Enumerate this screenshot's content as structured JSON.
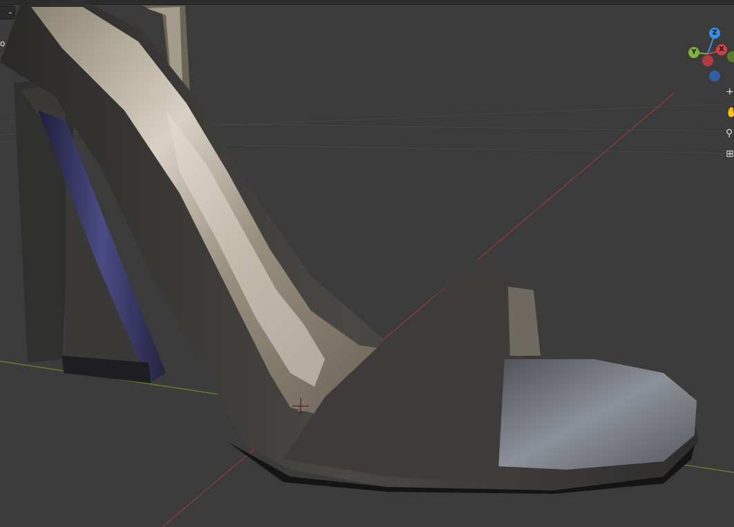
{
  "header": {
    "dropdown_glyph": "⌄",
    "overlay_text": "o"
  },
  "gizmo": {
    "z_label": "Z",
    "y_label": "Y",
    "x_label": "X",
    "colors": {
      "x": "#d0404a",
      "y": "#7fb13c",
      "z": "#3b8fe0",
      "neg_x": "#b33b43",
      "neg_z": "#2f5fa0"
    }
  },
  "nav_tools": [
    {
      "name": "zoom-tool",
      "icon": "plus-icon",
      "glyph": "+"
    },
    {
      "name": "move-view-tool",
      "icon": "hand-icon",
      "glyph": "✋"
    },
    {
      "name": "camera-view-tool",
      "icon": "camera-icon",
      "glyph": "⚲"
    },
    {
      "name": "toggle-perspective-tool",
      "icon": "grid-icon",
      "glyph": "⊞"
    }
  ],
  "scene": {
    "object": "high-heel sandal",
    "x_axis_color": "#9a3a3a",
    "y_axis_color": "#6a8a2a"
  }
}
